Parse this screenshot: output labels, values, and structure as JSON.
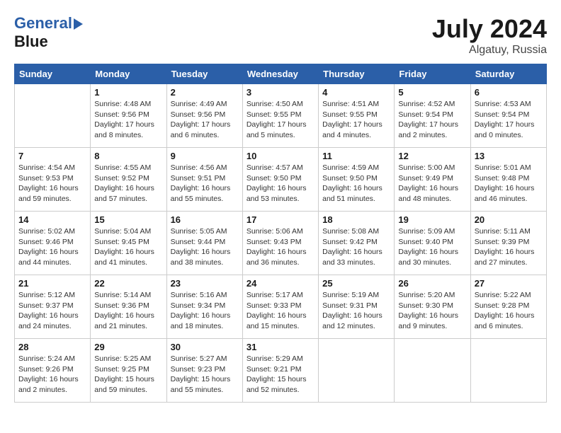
{
  "header": {
    "logo_line1": "General",
    "logo_line2": "Blue",
    "month_year": "July 2024",
    "location": "Algatuy, Russia"
  },
  "weekdays": [
    "Sunday",
    "Monday",
    "Tuesday",
    "Wednesday",
    "Thursday",
    "Friday",
    "Saturday"
  ],
  "weeks": [
    [
      {
        "day": "",
        "info": ""
      },
      {
        "day": "1",
        "info": "Sunrise: 4:48 AM\nSunset: 9:56 PM\nDaylight: 17 hours\nand 8 minutes."
      },
      {
        "day": "2",
        "info": "Sunrise: 4:49 AM\nSunset: 9:56 PM\nDaylight: 17 hours\nand 6 minutes."
      },
      {
        "day": "3",
        "info": "Sunrise: 4:50 AM\nSunset: 9:55 PM\nDaylight: 17 hours\nand 5 minutes."
      },
      {
        "day": "4",
        "info": "Sunrise: 4:51 AM\nSunset: 9:55 PM\nDaylight: 17 hours\nand 4 minutes."
      },
      {
        "day": "5",
        "info": "Sunrise: 4:52 AM\nSunset: 9:54 PM\nDaylight: 17 hours\nand 2 minutes."
      },
      {
        "day": "6",
        "info": "Sunrise: 4:53 AM\nSunset: 9:54 PM\nDaylight: 17 hours\nand 0 minutes."
      }
    ],
    [
      {
        "day": "7",
        "info": "Sunrise: 4:54 AM\nSunset: 9:53 PM\nDaylight: 16 hours\nand 59 minutes."
      },
      {
        "day": "8",
        "info": "Sunrise: 4:55 AM\nSunset: 9:52 PM\nDaylight: 16 hours\nand 57 minutes."
      },
      {
        "day": "9",
        "info": "Sunrise: 4:56 AM\nSunset: 9:51 PM\nDaylight: 16 hours\nand 55 minutes."
      },
      {
        "day": "10",
        "info": "Sunrise: 4:57 AM\nSunset: 9:50 PM\nDaylight: 16 hours\nand 53 minutes."
      },
      {
        "day": "11",
        "info": "Sunrise: 4:59 AM\nSunset: 9:50 PM\nDaylight: 16 hours\nand 51 minutes."
      },
      {
        "day": "12",
        "info": "Sunrise: 5:00 AM\nSunset: 9:49 PM\nDaylight: 16 hours\nand 48 minutes."
      },
      {
        "day": "13",
        "info": "Sunrise: 5:01 AM\nSunset: 9:48 PM\nDaylight: 16 hours\nand 46 minutes."
      }
    ],
    [
      {
        "day": "14",
        "info": "Sunrise: 5:02 AM\nSunset: 9:46 PM\nDaylight: 16 hours\nand 44 minutes."
      },
      {
        "day": "15",
        "info": "Sunrise: 5:04 AM\nSunset: 9:45 PM\nDaylight: 16 hours\nand 41 minutes."
      },
      {
        "day": "16",
        "info": "Sunrise: 5:05 AM\nSunset: 9:44 PM\nDaylight: 16 hours\nand 38 minutes."
      },
      {
        "day": "17",
        "info": "Sunrise: 5:06 AM\nSunset: 9:43 PM\nDaylight: 16 hours\nand 36 minutes."
      },
      {
        "day": "18",
        "info": "Sunrise: 5:08 AM\nSunset: 9:42 PM\nDaylight: 16 hours\nand 33 minutes."
      },
      {
        "day": "19",
        "info": "Sunrise: 5:09 AM\nSunset: 9:40 PM\nDaylight: 16 hours\nand 30 minutes."
      },
      {
        "day": "20",
        "info": "Sunrise: 5:11 AM\nSunset: 9:39 PM\nDaylight: 16 hours\nand 27 minutes."
      }
    ],
    [
      {
        "day": "21",
        "info": "Sunrise: 5:12 AM\nSunset: 9:37 PM\nDaylight: 16 hours\nand 24 minutes."
      },
      {
        "day": "22",
        "info": "Sunrise: 5:14 AM\nSunset: 9:36 PM\nDaylight: 16 hours\nand 21 minutes."
      },
      {
        "day": "23",
        "info": "Sunrise: 5:16 AM\nSunset: 9:34 PM\nDaylight: 16 hours\nand 18 minutes."
      },
      {
        "day": "24",
        "info": "Sunrise: 5:17 AM\nSunset: 9:33 PM\nDaylight: 16 hours\nand 15 minutes."
      },
      {
        "day": "25",
        "info": "Sunrise: 5:19 AM\nSunset: 9:31 PM\nDaylight: 16 hours\nand 12 minutes."
      },
      {
        "day": "26",
        "info": "Sunrise: 5:20 AM\nSunset: 9:30 PM\nDaylight: 16 hours\nand 9 minutes."
      },
      {
        "day": "27",
        "info": "Sunrise: 5:22 AM\nSunset: 9:28 PM\nDaylight: 16 hours\nand 6 minutes."
      }
    ],
    [
      {
        "day": "28",
        "info": "Sunrise: 5:24 AM\nSunset: 9:26 PM\nDaylight: 16 hours\nand 2 minutes."
      },
      {
        "day": "29",
        "info": "Sunrise: 5:25 AM\nSunset: 9:25 PM\nDaylight: 15 hours\nand 59 minutes."
      },
      {
        "day": "30",
        "info": "Sunrise: 5:27 AM\nSunset: 9:23 PM\nDaylight: 15 hours\nand 55 minutes."
      },
      {
        "day": "31",
        "info": "Sunrise: 5:29 AM\nSunset: 9:21 PM\nDaylight: 15 hours\nand 52 minutes."
      },
      {
        "day": "",
        "info": ""
      },
      {
        "day": "",
        "info": ""
      },
      {
        "day": "",
        "info": ""
      }
    ]
  ]
}
